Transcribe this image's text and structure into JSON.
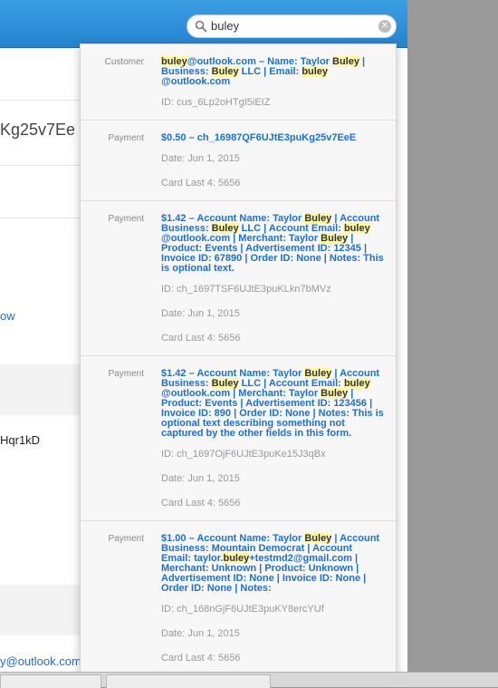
{
  "search": {
    "query": "buley"
  },
  "background": {
    "fragments": [
      "Kg25v7Ee",
      "ow",
      "Hqr1kD",
      "y@outlook.com"
    ]
  },
  "results": [
    {
      "type": "Customer",
      "title_parts": [
        {
          "t": "buley",
          "h": true
        },
        {
          "t": "@outlook.com – Name: Taylor ",
          "h": false
        },
        {
          "t": "Buley",
          "h": true
        },
        {
          "t": " | Business: ",
          "h": false
        },
        {
          "t": "Buley",
          "h": true
        },
        {
          "t": " LLC | Email: ",
          "h": false
        },
        {
          "t": "buley",
          "h": true
        },
        {
          "t": " @outlook.com",
          "h": false
        }
      ],
      "meta": [
        "ID: cus_6Lp2oHTgI5iEIZ"
      ]
    },
    {
      "type": "Payment",
      "title_parts": [
        {
          "t": "$0.50 – ch_16987QF6UJtE3puKg25v7EeE",
          "h": false
        }
      ],
      "meta": [
        "Date: Jun 1, 2015",
        "Card Last 4: 5656"
      ]
    },
    {
      "type": "Payment",
      "title_parts": [
        {
          "t": "$1.42 – Account Name: Taylor ",
          "h": false
        },
        {
          "t": "Buley",
          "h": true
        },
        {
          "t": " | Account Business: ",
          "h": false
        },
        {
          "t": "Buley",
          "h": true
        },
        {
          "t": " LLC | Account Email: ",
          "h": false
        },
        {
          "t": "buley",
          "h": true
        },
        {
          "t": " @outlook.com | Merchant: Taylor ",
          "h": false
        },
        {
          "t": "Buley",
          "h": true
        },
        {
          "t": " | Product: Events | Advertisement ID: 12345 | Invoice ID: 67890 | Order ID: None | Notes: This is optional text.",
          "h": false
        }
      ],
      "meta": [
        "ID: ch_1697TSF6UJtE3puKLkn7bMVz",
        "Date: Jun 1, 2015",
        "Card Last 4: 5656"
      ]
    },
    {
      "type": "Payment",
      "title_parts": [
        {
          "t": "$1.42 – Account Name: Taylor ",
          "h": false
        },
        {
          "t": "Buley",
          "h": true
        },
        {
          "t": " | Account Business: ",
          "h": false
        },
        {
          "t": "Buley",
          "h": true
        },
        {
          "t": " LLC | Account Email: ",
          "h": false
        },
        {
          "t": "buley",
          "h": true
        },
        {
          "t": " @outlook.com | Merchant: Taylor ",
          "h": false
        },
        {
          "t": "Buley",
          "h": true
        },
        {
          "t": " | Product: Events | Advertisement ID: 123456 | Invoice ID: 890 | Order ID: None | Notes: This is optional text describing something not captured by the other fields in this form.",
          "h": false
        }
      ],
      "meta": [
        "ID: ch_1697OjF6UJtE3puKe15J3qBx",
        "Date: Jun 1, 2015",
        "Card Last 4: 5656"
      ]
    },
    {
      "type": "Payment",
      "title_parts": [
        {
          "t": "$1.00 – Account Name: Taylor ",
          "h": false
        },
        {
          "t": "Buley",
          "h": true
        },
        {
          "t": " | Account Business: Mountain Democrat | Account Email: taylor.",
          "h": false
        },
        {
          "t": "buley",
          "h": true
        },
        {
          "t": "+testmd2@gmail.com | Merchant: Unknown | Product: Unknown | Advertisement ID: None | Invoice ID: None | Order ID: None | Notes:",
          "h": false
        }
      ],
      "meta": [
        "ID: ch_168nGjF6UJtE3puKY8ercYUf",
        "Date: Jun 1, 2015",
        "Card Last 4: 5656"
      ]
    }
  ],
  "colors": {
    "topbar": "#2b8fd8",
    "link": "#1c6fd1",
    "highlight": "#fff7a8"
  }
}
